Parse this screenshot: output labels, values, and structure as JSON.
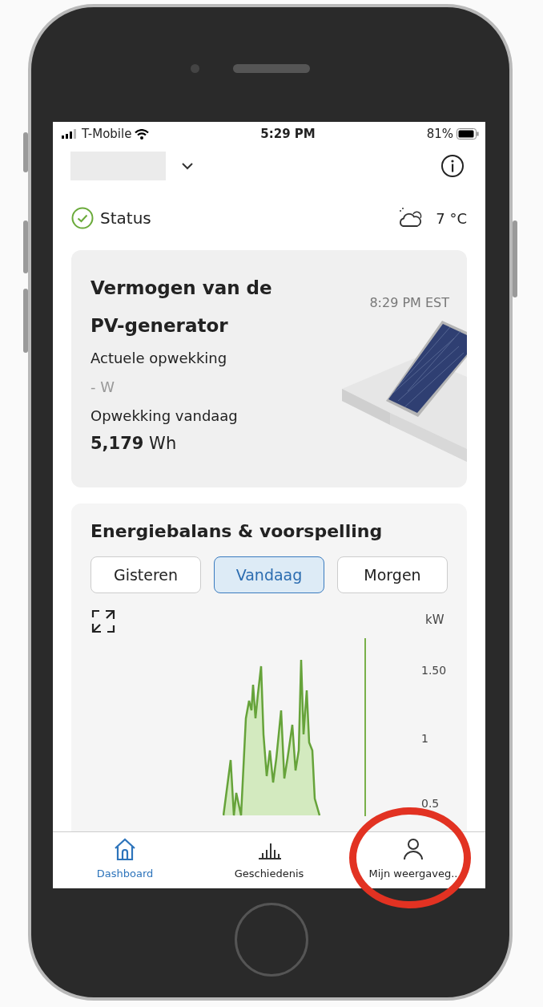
{
  "status_bar": {
    "carrier": "T-Mobile",
    "time": "5:29 PM",
    "battery": "81%"
  },
  "status": {
    "label": "Status",
    "ok": true,
    "temperature": "7 °C"
  },
  "pv_card": {
    "title": "Vermogen van de PV-generator",
    "timestamp": "8:29 PM EST",
    "current_label": "Actuele opwekking",
    "current_value": "- W",
    "today_label": "Opwekking vandaag",
    "today_value": "5,179",
    "today_unit": "Wh"
  },
  "energy_card": {
    "title": "Energiebalans & voorspelling",
    "tabs": [
      {
        "label": "Gisteren",
        "selected": false
      },
      {
        "label": "Vandaag",
        "selected": true
      },
      {
        "label": "Morgen",
        "selected": false
      }
    ],
    "chart": {
      "unit": "kW",
      "y_labels": [
        "1.50",
        "1",
        "0.5"
      ]
    }
  },
  "bottom_nav": [
    {
      "label": "Dashboard",
      "selected": true
    },
    {
      "label": "Geschiedenis",
      "selected": false
    },
    {
      "label": "Mijn weergaveg..",
      "selected": false
    }
  ]
}
